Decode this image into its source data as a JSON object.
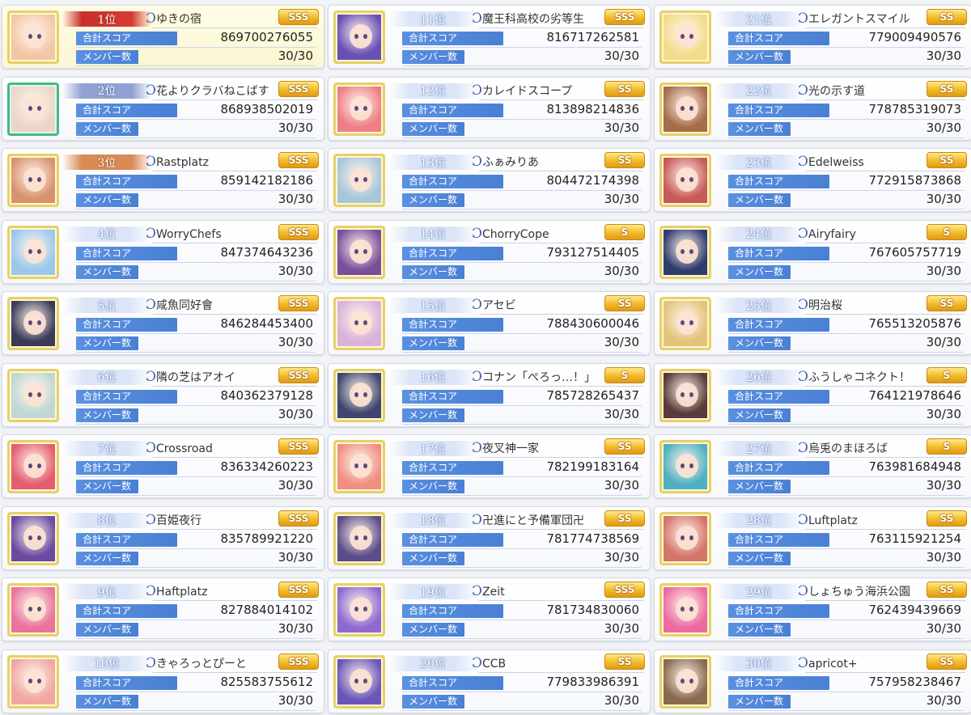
{
  "labels": {
    "score": "合計スコア",
    "members": "メンバー数"
  },
  "clans": [
    {
      "rank": "1位",
      "name": "ゆきの宿",
      "tier": "SSS",
      "score": "869700276055",
      "members": "30/30",
      "medal": "top",
      "portrait_color": "#f2c7a6"
    },
    {
      "rank": "2位",
      "name": "花よりクラバねこばす",
      "tier": "SSS",
      "score": "868938502019",
      "members": "30/30",
      "medal": "silver",
      "portrait_color": "#ead6c8"
    },
    {
      "rank": "3位",
      "name": "Rastplatz",
      "tier": "SSS",
      "score": "859142182186",
      "members": "30/30",
      "medal": "bronze",
      "portrait_color": "#d9926e"
    },
    {
      "rank": "4位",
      "name": "WorryChefs",
      "tier": "SSS",
      "score": "847374643236",
      "members": "30/30",
      "medal": "",
      "portrait_color": "#9cc7ec"
    },
    {
      "rank": "5位",
      "name": "咸魚同好會",
      "tier": "SSS",
      "score": "846284453400",
      "members": "30/30",
      "medal": "",
      "portrait_color": "#3b3b58"
    },
    {
      "rank": "6位",
      "name": "隣の芝はアオイ",
      "tier": "SSS",
      "score": "840362379128",
      "members": "30/30",
      "medal": "",
      "portrait_color": "#bfd8d2"
    },
    {
      "rank": "7位",
      "name": "Crossroad",
      "tier": "SSS",
      "score": "836334260223",
      "members": "30/30",
      "medal": "",
      "portrait_color": "#e45d70"
    },
    {
      "rank": "8位",
      "name": "百姫夜行",
      "tier": "SSS",
      "score": "835789921220",
      "members": "30/30",
      "medal": "",
      "portrait_color": "#6b4aa0"
    },
    {
      "rank": "9位",
      "name": "Haftplatz",
      "tier": "SSS",
      "score": "827884014102",
      "members": "30/30",
      "medal": "",
      "portrait_color": "#e9739a"
    },
    {
      "rank": "10位",
      "name": "きゃろっとぴーと",
      "tier": "SSS",
      "score": "825583755612",
      "members": "30/30",
      "medal": "",
      "portrait_color": "#f0a7a0"
    },
    {
      "rank": "11位",
      "name": "魔王科高校の劣等生",
      "tier": "SSS",
      "score": "816717262581",
      "members": "30/30",
      "medal": "",
      "portrait_color": "#6a4fb4"
    },
    {
      "rank": "12位",
      "name": "カレイドスコープ",
      "tier": "SS",
      "score": "813898214836",
      "members": "30/30",
      "medal": "",
      "portrait_color": "#ef7f86"
    },
    {
      "rank": "13位",
      "name": "ふぁみりあ",
      "tier": "SS",
      "score": "804472174398",
      "members": "30/30",
      "medal": "",
      "portrait_color": "#a9c6d8"
    },
    {
      "rank": "14位",
      "name": "ChorryCope",
      "tier": "S",
      "score": "793127514405",
      "members": "30/30",
      "medal": "",
      "portrait_color": "#7b4e9a"
    },
    {
      "rank": "15位",
      "name": "アセビ",
      "tier": "SS",
      "score": "788430600046",
      "members": "30/30",
      "medal": "",
      "portrait_color": "#d9b2d9"
    },
    {
      "rank": "16位",
      "name": "コナン「ぺろっ…！」",
      "tier": "S",
      "score": "785728265437",
      "members": "30/30",
      "medal": "",
      "portrait_color": "#3e466e"
    },
    {
      "rank": "17位",
      "name": "夜叉神一家",
      "tier": "SS",
      "score": "782199183164",
      "members": "30/30",
      "medal": "",
      "portrait_color": "#f08f80"
    },
    {
      "rank": "18位",
      "name": "卍進にと予備軍団卍",
      "tier": "SS",
      "score": "781774738569",
      "members": "30/30",
      "medal": "",
      "portrait_color": "#5d4c8a"
    },
    {
      "rank": "19位",
      "name": "Zeit",
      "tier": "SSS",
      "score": "781734830060",
      "members": "30/30",
      "medal": "",
      "portrait_color": "#8e6ad0"
    },
    {
      "rank": "20位",
      "name": "CCB",
      "tier": "SS",
      "score": "779833986391",
      "members": "30/30",
      "medal": "",
      "portrait_color": "#6b55b8"
    },
    {
      "rank": "21位",
      "name": "エレガントスマイル",
      "tier": "SS",
      "score": "779009490576",
      "members": "30/30",
      "medal": "",
      "portrait_color": "#f2dc8a"
    },
    {
      "rank": "22位",
      "name": "光の示す道",
      "tier": "SS",
      "score": "778785319073",
      "members": "30/30",
      "medal": "",
      "portrait_color": "#a86c4a"
    },
    {
      "rank": "23位",
      "name": "Edelweiss",
      "tier": "SS",
      "score": "772915873868",
      "members": "30/30",
      "medal": "",
      "portrait_color": "#c85a5a"
    },
    {
      "rank": "24位",
      "name": "Airyfairy",
      "tier": "S",
      "score": "767605757719",
      "members": "30/30",
      "medal": "",
      "portrait_color": "#2f3d6e"
    },
    {
      "rank": "25位",
      "name": "明治桜",
      "tier": "SS",
      "score": "765513205876",
      "members": "30/30",
      "medal": "",
      "portrait_color": "#e3c27a"
    },
    {
      "rank": "26位",
      "name": "ふうしゃコネクト！",
      "tier": "S",
      "score": "764121978646",
      "members": "30/30",
      "medal": "",
      "portrait_color": "#5a3a3a"
    },
    {
      "rank": "27位",
      "name": "烏兎のまほろば",
      "tier": "S",
      "score": "763981684948",
      "members": "30/30",
      "medal": "",
      "portrait_color": "#4eb0c0"
    },
    {
      "rank": "28位",
      "name": "Luftplatz",
      "tier": "SS",
      "score": "763115921254",
      "members": "30/30",
      "medal": "",
      "portrait_color": "#d4746a"
    },
    {
      "rank": "29位",
      "name": "しょちゅう海浜公園",
      "tier": "SS",
      "score": "762439439669",
      "members": "30/30",
      "medal": "",
      "portrait_color": "#ec6aa0"
    },
    {
      "rank": "30位",
      "name": "apricot+",
      "tier": "SS",
      "score": "757958238467",
      "members": "30/30",
      "medal": "",
      "portrait_color": "#8a6a4e"
    }
  ]
}
